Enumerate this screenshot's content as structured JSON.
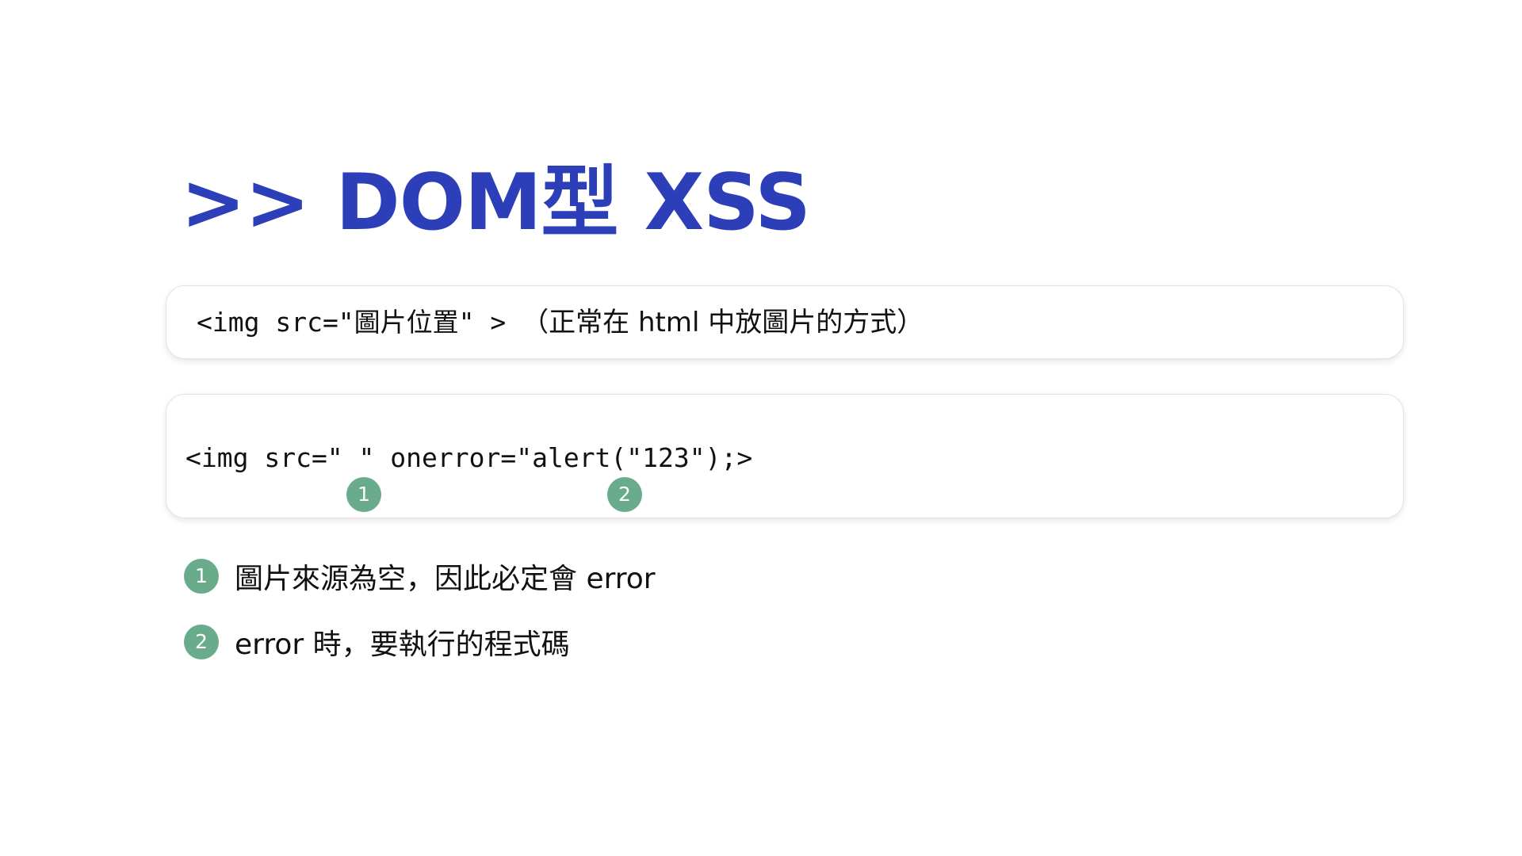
{
  "slide": {
    "title": ">> DOM型 XSS"
  },
  "example_card": {
    "code": "<img src=\"圖片位置\" > ",
    "comment": "（正常在 html 中放圖片的方式）"
  },
  "payload_card": {
    "code": "<img src=\" \" onerror=\"alert(\"123\");>",
    "markers": [
      "1",
      "2"
    ]
  },
  "notes": [
    {
      "marker": "1",
      "text": "圖片來源為空，因此必定會 error"
    },
    {
      "marker": "2",
      "text": "error 時，要執行的程式碼"
    }
  ],
  "colors": {
    "title": "#2c3fb8",
    "marker": "#6aab8c",
    "text": "#111111"
  }
}
